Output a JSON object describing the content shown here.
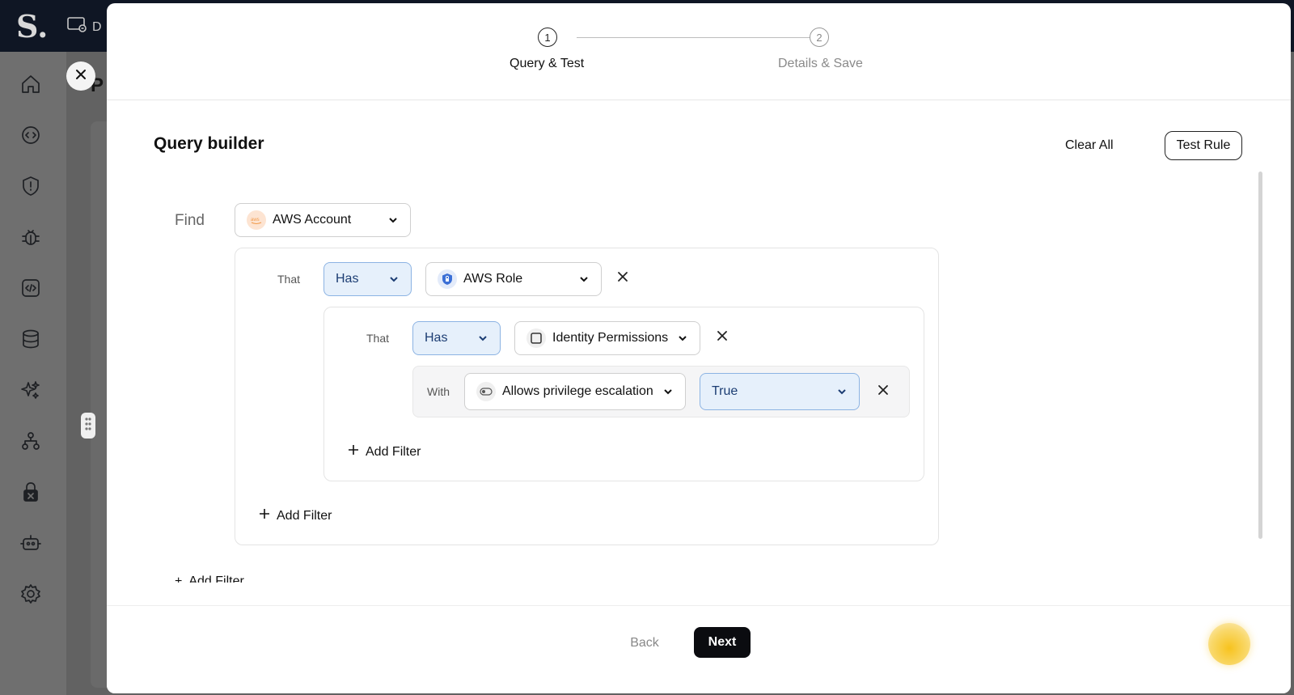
{
  "app": {
    "logo_text": "S.",
    "topbar_tab_letter": "D",
    "bg_title_letter": "P"
  },
  "stepper": {
    "steps": [
      {
        "number": "1",
        "label": "Query & Test",
        "active": true
      },
      {
        "number": "2",
        "label": "Details & Save",
        "active": false
      }
    ]
  },
  "query_builder": {
    "title": "Query builder",
    "clear_all_label": "Clear All",
    "test_rule_label": "Test Rule",
    "find_label": "Find",
    "find_entity": {
      "label": "AWS Account",
      "icon": "aws-icon"
    },
    "level1": {
      "that_label": "That",
      "relation": "Has",
      "entity": {
        "label": "AWS Role",
        "icon": "aws-role-icon"
      },
      "level2": {
        "that_label": "That",
        "relation": "Has",
        "entity": {
          "label": "Identity Permissions",
          "icon": "permissions-icon"
        },
        "with": {
          "label": "With",
          "property": {
            "label": "Allows privilege escalation",
            "icon": "toggle-icon"
          },
          "value": "True"
        },
        "add_filter_label": "Add Filter"
      },
      "add_filter_label": "Add Filter"
    },
    "add_filter_label": "Add Filter"
  },
  "footer": {
    "back_label": "Back",
    "next_label": "Next"
  },
  "colors": {
    "accent_blue_bg": "#e6f0fb",
    "accent_blue_border": "#8cb3e3",
    "primary_button": "#0b0c10",
    "aws_orange": "#f29a4a",
    "role_blue": "#3b6fd6"
  }
}
